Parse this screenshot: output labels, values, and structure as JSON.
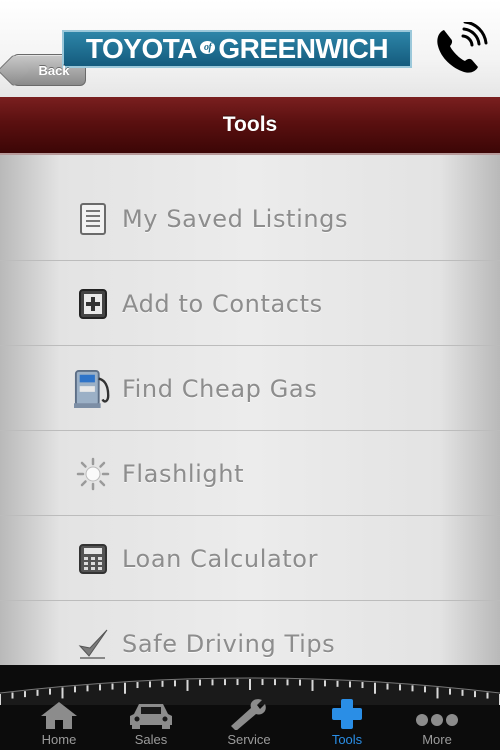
{
  "header": {
    "back_label": "Back",
    "logo_left": "TOYOTA",
    "logo_of": "of",
    "logo_right": "GREENWICH"
  },
  "page": {
    "title": "Tools"
  },
  "menu": {
    "items": [
      {
        "label": "My Saved Listings",
        "icon": "listing-document-icon"
      },
      {
        "label": "Add to Contacts",
        "icon": "add-contact-icon"
      },
      {
        "label": "Find Cheap Gas",
        "icon": "gas-pump-icon"
      },
      {
        "label": "Flashlight",
        "icon": "flashlight-icon"
      },
      {
        "label": "Loan Calculator",
        "icon": "calculator-icon"
      },
      {
        "label": "Safe Driving Tips",
        "icon": "checkmark-icon"
      }
    ]
  },
  "tabs": [
    {
      "label": "Home",
      "icon": "home-icon"
    },
    {
      "label": "Sales",
      "icon": "car-icon"
    },
    {
      "label": "Service",
      "icon": "wrench-icon"
    },
    {
      "label": "Tools",
      "icon": "plus-icon",
      "active": true
    },
    {
      "label": "More",
      "icon": "more-dots-icon"
    }
  ],
  "colors": {
    "titlebar": "#5a1010",
    "logo_blue": "#1f6f93",
    "active_tab": "#2a8ee6",
    "label_gray": "#8d8d8d"
  }
}
